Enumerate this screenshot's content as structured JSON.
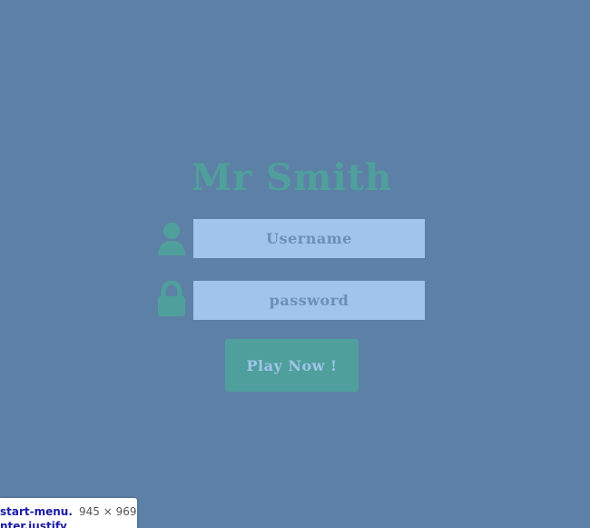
{
  "login": {
    "title": "Mr Smith",
    "username": {
      "placeholder": "Username",
      "value": "",
      "icon": "user-icon"
    },
    "password": {
      "placeholder": "password",
      "value": "",
      "icon": "lock-icon"
    },
    "submit_label": "Play Now !"
  },
  "devtools_tooltip": {
    "selector_line1": "start-menu.",
    "selector_line2": "nter.justify",
    "dimensions": "945 × 969"
  },
  "colors": {
    "background": "#5d81a6",
    "accent": "#4fa09c",
    "field": "#a1c4ea"
  }
}
